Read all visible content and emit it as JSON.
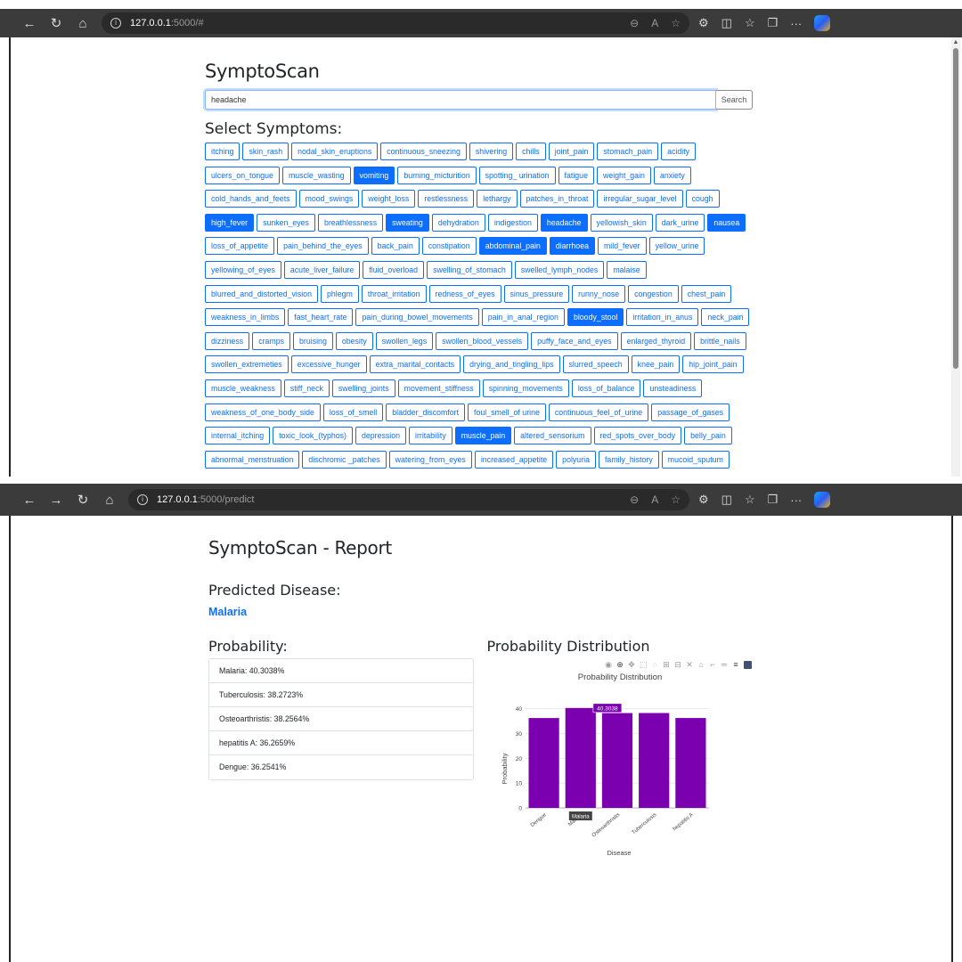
{
  "browser1": {
    "url_host": "127.0.0.1",
    "url_path": ":5000/#"
  },
  "browser2": {
    "url_host": "127.0.0.1",
    "url_path": ":5000/predict"
  },
  "page1": {
    "title": "SymptoScan",
    "search_value": "headache",
    "search_button": "Search",
    "symptoms_heading": "Select Symptoms:",
    "symptoms": [
      {
        "label": "itching",
        "selected": false
      },
      {
        "label": "skin_rash",
        "selected": false
      },
      {
        "label": "nodal_skin_eruptions",
        "selected": false
      },
      {
        "label": "continuous_sneezing",
        "selected": false
      },
      {
        "label": "shivering",
        "selected": false
      },
      {
        "label": "chills",
        "selected": false
      },
      {
        "label": "joint_pain",
        "selected": false
      },
      {
        "label": "stomach_pain",
        "selected": false
      },
      {
        "label": "acidity",
        "selected": false
      },
      {
        "label": "ulcers_on_tongue",
        "selected": false
      },
      {
        "label": "muscle_wasting",
        "selected": false
      },
      {
        "label": "vomiting",
        "selected": true
      },
      {
        "label": "burning_micturition",
        "selected": false
      },
      {
        "label": "spotting_ urination",
        "selected": false
      },
      {
        "label": "fatigue",
        "selected": false
      },
      {
        "label": "weight_gain",
        "selected": false
      },
      {
        "label": "anxiety",
        "selected": false
      },
      {
        "label": "cold_hands_and_feets",
        "selected": false
      },
      {
        "label": "mood_swings",
        "selected": false
      },
      {
        "label": "weight_loss",
        "selected": false
      },
      {
        "label": "restlessness",
        "selected": false
      },
      {
        "label": "lethargy",
        "selected": false
      },
      {
        "label": "patches_in_throat",
        "selected": false
      },
      {
        "label": "irregular_sugar_level",
        "selected": false
      },
      {
        "label": "cough",
        "selected": false
      },
      {
        "label": "high_fever",
        "selected": true
      },
      {
        "label": "sunken_eyes",
        "selected": false
      },
      {
        "label": "breathlessness",
        "selected": false
      },
      {
        "label": "sweating",
        "selected": true
      },
      {
        "label": "dehydration",
        "selected": false
      },
      {
        "label": "indigestion",
        "selected": false
      },
      {
        "label": "headache",
        "selected": true
      },
      {
        "label": "yellowish_skin",
        "selected": false
      },
      {
        "label": "dark_urine",
        "selected": false
      },
      {
        "label": "nausea",
        "selected": true
      },
      {
        "label": "loss_of_appetite",
        "selected": false
      },
      {
        "label": "pain_behind_the_eyes",
        "selected": false
      },
      {
        "label": "back_pain",
        "selected": false
      },
      {
        "label": "constipation",
        "selected": false
      },
      {
        "label": "abdominal_pain",
        "selected": true
      },
      {
        "label": "diarrhoea",
        "selected": true
      },
      {
        "label": "mild_fever",
        "selected": false
      },
      {
        "label": "yellow_urine",
        "selected": false
      },
      {
        "label": "yellowing_of_eyes",
        "selected": false
      },
      {
        "label": "acute_liver_failure",
        "selected": false
      },
      {
        "label": "fluid_overload",
        "selected": false
      },
      {
        "label": "swelling_of_stomach",
        "selected": false
      },
      {
        "label": "swelled_lymph_nodes",
        "selected": false
      },
      {
        "label": "malaise",
        "selected": false
      },
      {
        "label": "blurred_and_distorted_vision",
        "selected": false
      },
      {
        "label": "phlegm",
        "selected": false
      },
      {
        "label": "throat_irritation",
        "selected": false
      },
      {
        "label": "redness_of_eyes",
        "selected": false
      },
      {
        "label": "sinus_pressure",
        "selected": false
      },
      {
        "label": "runny_nose",
        "selected": false
      },
      {
        "label": "congestion",
        "selected": false
      },
      {
        "label": "chest_pain",
        "selected": false
      },
      {
        "label": "weakness_in_limbs",
        "selected": false
      },
      {
        "label": "fast_heart_rate",
        "selected": false
      },
      {
        "label": "pain_during_bowel_movements",
        "selected": false
      },
      {
        "label": "pain_in_anal_region",
        "selected": false
      },
      {
        "label": "bloody_stool",
        "selected": true
      },
      {
        "label": "irritation_in_anus",
        "selected": false
      },
      {
        "label": "neck_pain",
        "selected": false
      },
      {
        "label": "dizziness",
        "selected": false
      },
      {
        "label": "cramps",
        "selected": false
      },
      {
        "label": "bruising",
        "selected": false
      },
      {
        "label": "obesity",
        "selected": false
      },
      {
        "label": "swollen_legs",
        "selected": false
      },
      {
        "label": "swollen_blood_vessels",
        "selected": false
      },
      {
        "label": "puffy_face_and_eyes",
        "selected": false
      },
      {
        "label": "enlarged_thyroid",
        "selected": false
      },
      {
        "label": "brittle_nails",
        "selected": false
      },
      {
        "label": "swollen_extremeties",
        "selected": false
      },
      {
        "label": "excessive_hunger",
        "selected": false
      },
      {
        "label": "extra_marital_contacts",
        "selected": false
      },
      {
        "label": "drying_and_tingling_lips",
        "selected": false
      },
      {
        "label": "slurred_speech",
        "selected": false
      },
      {
        "label": "knee_pain",
        "selected": false
      },
      {
        "label": "hip_joint_pain",
        "selected": false
      },
      {
        "label": "muscle_weakness",
        "selected": false
      },
      {
        "label": "stiff_neck",
        "selected": false
      },
      {
        "label": "swelling_joints",
        "selected": false
      },
      {
        "label": "movement_stiffness",
        "selected": false
      },
      {
        "label": "spinning_movements",
        "selected": false
      },
      {
        "label": "loss_of_balance",
        "selected": false
      },
      {
        "label": "unsteadiness",
        "selected": false
      },
      {
        "label": "weakness_of_one_body_side",
        "selected": false
      },
      {
        "label": "loss_of_smell",
        "selected": false
      },
      {
        "label": "bladder_discomfort",
        "selected": false
      },
      {
        "label": "foul_smell_of urine",
        "selected": false
      },
      {
        "label": "continuous_feel_of_urine",
        "selected": false
      },
      {
        "label": "passage_of_gases",
        "selected": false
      },
      {
        "label": "internal_itching",
        "selected": false
      },
      {
        "label": "toxic_look_(typhos)",
        "selected": false
      },
      {
        "label": "depression",
        "selected": false
      },
      {
        "label": "irritability",
        "selected": false
      },
      {
        "label": "muscle_pain",
        "selected": true
      },
      {
        "label": "altered_sensorium",
        "selected": false
      },
      {
        "label": "red_spots_over_body",
        "selected": false
      },
      {
        "label": "belly_pain",
        "selected": false
      },
      {
        "label": "abnormal_menstruation",
        "selected": false
      },
      {
        "label": "dischromic _patches",
        "selected": false
      },
      {
        "label": "watering_from_eyes",
        "selected": false
      },
      {
        "label": "increased_appetite",
        "selected": false
      },
      {
        "label": "polyuria",
        "selected": false
      },
      {
        "label": "family_history",
        "selected": false
      },
      {
        "label": "mucoid_sputum",
        "selected": false
      }
    ]
  },
  "page2": {
    "title": "SymptoScan - Report",
    "predicted_heading": "Predicted Disease:",
    "predicted_value": "Malaria",
    "probability_heading": "Probability:",
    "probabilities": [
      "Malaria: 40.3038%",
      "Tuberculosis: 38.2723%",
      "Osteoarthristis: 38.2564%",
      "hepatitis A: 36.2659%",
      "Dengue: 36.2541%"
    ],
    "distribution_heading": "Probability Distribution"
  },
  "colors": {
    "primary": "#0d6efd",
    "bar": "#7a00b0"
  },
  "chart_data": {
    "type": "bar",
    "title": "Probability Distribution",
    "xlabel": "Disease",
    "ylabel": "Probability",
    "categories": [
      "Dengue",
      "Malaria",
      "Osteoarthristis",
      "Tuberculosis",
      "hepatitis A"
    ],
    "values": [
      36.2541,
      40.3038,
      38.2564,
      38.2723,
      36.2659
    ],
    "ylim": [
      0,
      42.4
    ],
    "yticks": [
      0,
      10,
      20,
      30,
      40
    ],
    "hover": {
      "category": "Malaria",
      "value_label": "40.3038"
    },
    "grid": true
  }
}
